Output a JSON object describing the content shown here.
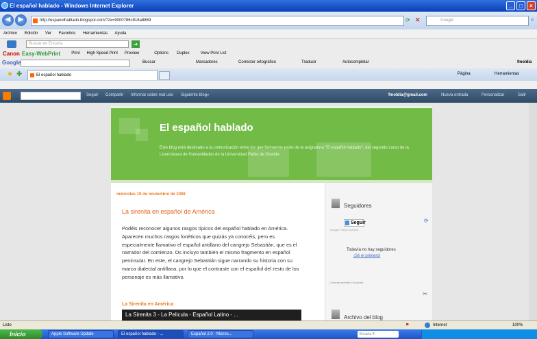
{
  "window": {
    "title": "El español hablado - Windows Internet Explorer"
  },
  "address": {
    "url": "http://espanolhablado.blogspot.com/?zx=9000786c918a8869"
  },
  "search_box": {
    "placeholder": "Google"
  },
  "menu": [
    "Archivo",
    "Edición",
    "Ver",
    "Favoritos",
    "Herramientas",
    "Ayuda"
  ],
  "ask_bar": {
    "placeholder": "Buscar en Encarta"
  },
  "canon_bar": {
    "brand": "Canon",
    "product": "Easy-WebPrint",
    "items": [
      "Print",
      "High Speed Print",
      "Preview",
      "Options",
      "Duplex",
      "View Print List"
    ]
  },
  "google_bar": {
    "brand": "Google",
    "items": [
      "Buscar",
      "Marcadores",
      "Corrector ortográfico",
      "Traducir",
      "Autocompletar"
    ],
    "user": "fmoldia"
  },
  "tabs": {
    "active": "El español hablado",
    "right": [
      "Página",
      "Herramientas"
    ]
  },
  "blogger": {
    "links": [
      "Seguir",
      "Compartir",
      "Informar sobre mal uso",
      "Siguiente blog»"
    ],
    "email": "fmoldia@gmail.com",
    "right_links": [
      "Nueva entrada",
      "Personalizar",
      "Salir"
    ]
  },
  "blog": {
    "title": "El español hablado",
    "description": "Este blog está destinado a la comunicación entre los que formamos parte de la asignatura \"El español hablado\", del segundo curso de la Licenciatura de Humanidades de la Universidad Pablo de Olavide.",
    "post_date": "miércoles 19 de noviembre de 2008",
    "post_title": "La sirenita en español de América",
    "post_body": "Podéis reconocer algunos rasgos típicos del español hablado en América. Aparecen muchos rasgos fonéticos que quizás ya conocéis, pero es especialmente llamativo el español antillano del cangrejo Sebastián, que es el narrador del comienzo. Os incluyo también el mismo fragmento en español peninsular. En este, el cangrejo Sebastián sigue narrando su historia con su marca dialectal antillana, por lo que el contraste con el español del resto de los personaje es más llamativo.",
    "subheading": "La Sirenita en América",
    "video_title": "La Sirenita 3 - La Pelicula - Español Latino - ..."
  },
  "sidebar": {
    "followers_title": "Seguidores",
    "follow_button": "Seguir",
    "gfc": "Google Friend Connect",
    "no_followers": "Todavía no hay seguidores",
    "be_first": "¡Sé el primero!",
    "member": "¿Ya eres miembro? Acceder",
    "archive_title": "Archivo del blog"
  },
  "status": {
    "left": "Listo",
    "zone": "Internet",
    "zoom": "100%"
  },
  "taskbar": {
    "start": "Inicio",
    "tasks": [
      "Apple Software Update",
      "El español hablado - ...",
      "Español 2.0 - Micros..."
    ],
    "search": "Encarta ®"
  }
}
